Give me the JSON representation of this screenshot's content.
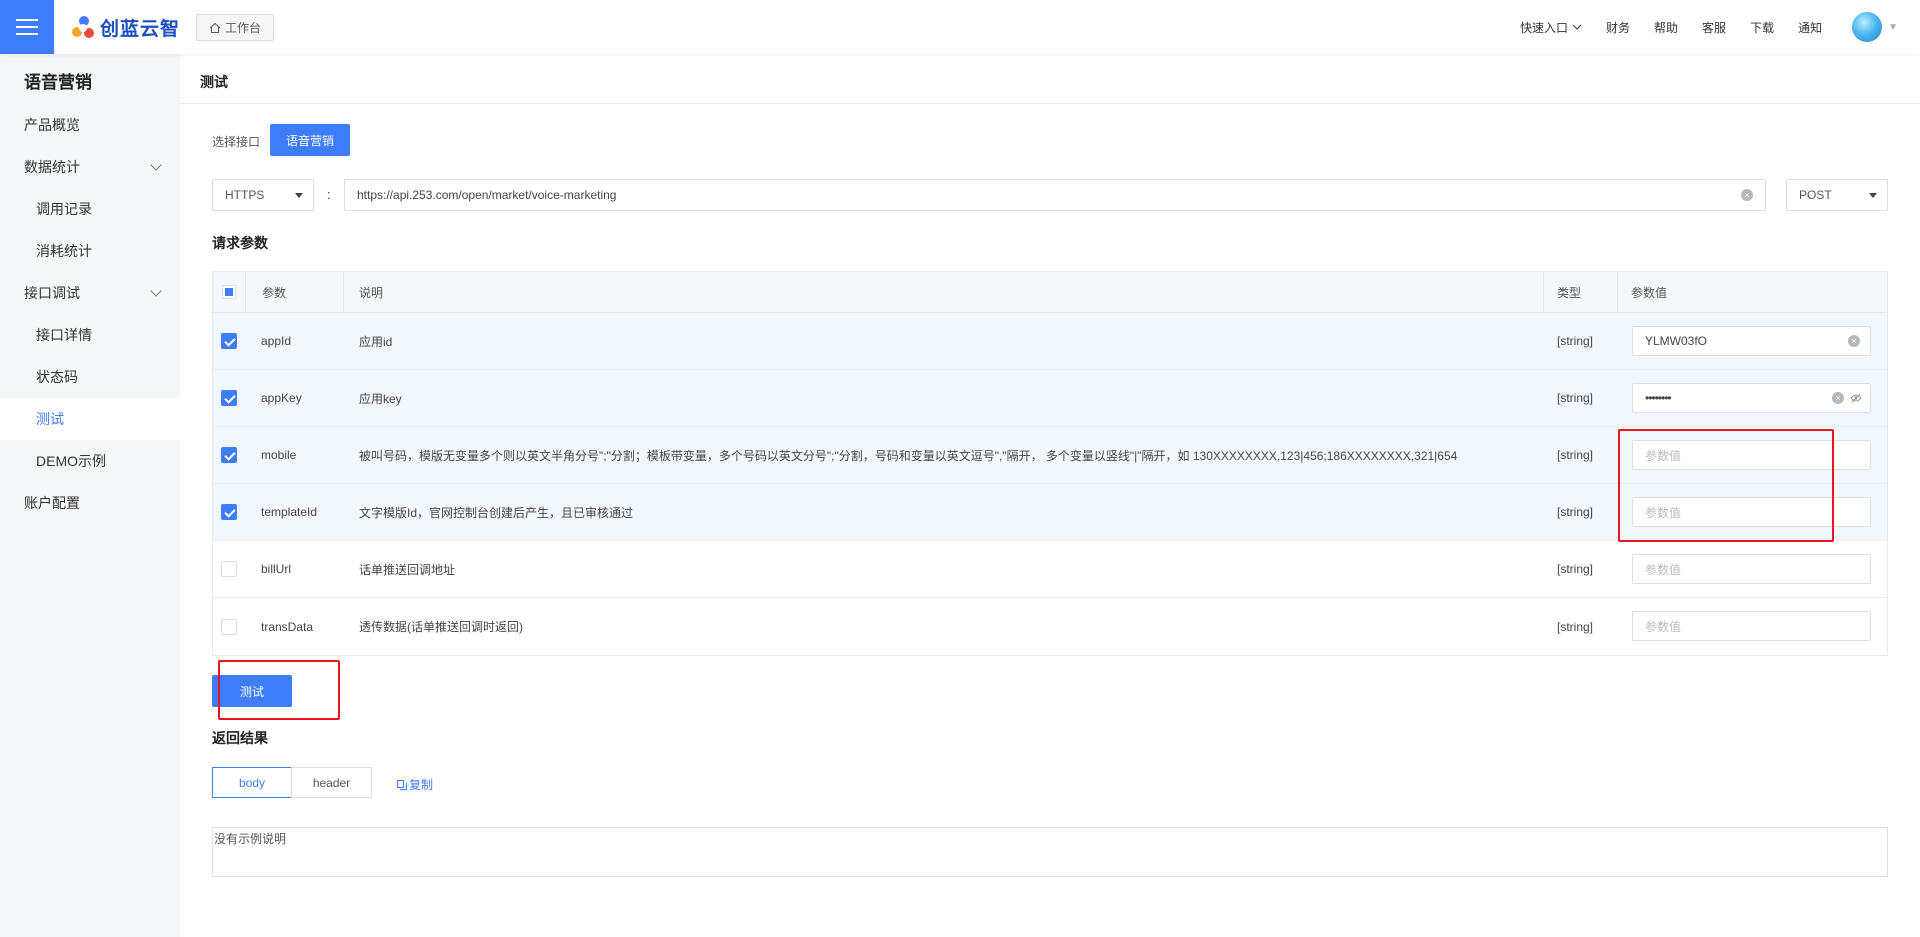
{
  "header": {
    "logo_text": "创蓝云智",
    "workbench_label": "工作台",
    "nav": {
      "quick_entry": "快速入口",
      "finance": "财务",
      "help": "帮助",
      "service": "客服",
      "download": "下载",
      "notify": "通知"
    }
  },
  "sidebar": {
    "title": "语音营销",
    "items": [
      {
        "label": "产品概览"
      },
      {
        "label": "数据统计"
      },
      {
        "label": "调用记录"
      },
      {
        "label": "消耗统计"
      },
      {
        "label": "接口调试"
      },
      {
        "label": "接口详情"
      },
      {
        "label": "状态码"
      },
      {
        "label": "测试"
      },
      {
        "label": "DEMO示例"
      },
      {
        "label": "账户配置"
      }
    ]
  },
  "main": {
    "page_title": "测试",
    "select_api_label": "选择接口",
    "api_button": "语音营销",
    "protocol": "HTTPS",
    "separator": ":",
    "url": "https://api.253.com/open/market/voice-marketing",
    "method": "POST",
    "params_title": "请求参数",
    "table": {
      "headers": {
        "param": "参数",
        "desc": "说明",
        "type": "类型",
        "value": "参数值"
      },
      "rows": [
        {
          "name": "appId",
          "desc": "应用id",
          "type": "[string]",
          "value": "YLMW03fO",
          "placeholder": "参数值",
          "checked": true
        },
        {
          "name": "appKey",
          "desc": "应用key",
          "type": "[string]",
          "value": "••••••••",
          "placeholder": "参数值",
          "checked": true
        },
        {
          "name": "mobile",
          "desc": "被叫号码，模版无变量多个则以英文半角分号\";\"分割；模板带变量，多个号码以英文分号\";\"分割，号码和变量以英文逗号\",\"隔开， 多个变量以竖线\"|\"隔开，如 130XXXXXXXX,123|456;186XXXXXXXX,321|654",
          "type": "[string]",
          "value": "",
          "placeholder": "参数值",
          "checked": true
        },
        {
          "name": "templateId",
          "desc": "文字模版Id，官网控制台创建后产生，且已审核通过",
          "type": "[string]",
          "value": "",
          "placeholder": "参数值",
          "checked": true
        },
        {
          "name": "billUrl",
          "desc": "话单推送回调地址",
          "type": "[string]",
          "value": "",
          "placeholder": "参数值",
          "checked": false
        },
        {
          "name": "transData",
          "desc": "透传数据(话单推送回调时返回)",
          "type": "[string]",
          "value": "",
          "placeholder": "参数值",
          "checked": false
        }
      ]
    },
    "test_button": "测试",
    "result_title": "返回结果",
    "tabs": [
      {
        "label": "body"
      },
      {
        "label": "header"
      }
    ],
    "copy_label": "复制",
    "result_text": "没有示例说明"
  },
  "colors": {
    "accent": "#3f7cf9",
    "highlight": "#e8171c",
    "sidebar_bg": "#f5f6f8"
  }
}
